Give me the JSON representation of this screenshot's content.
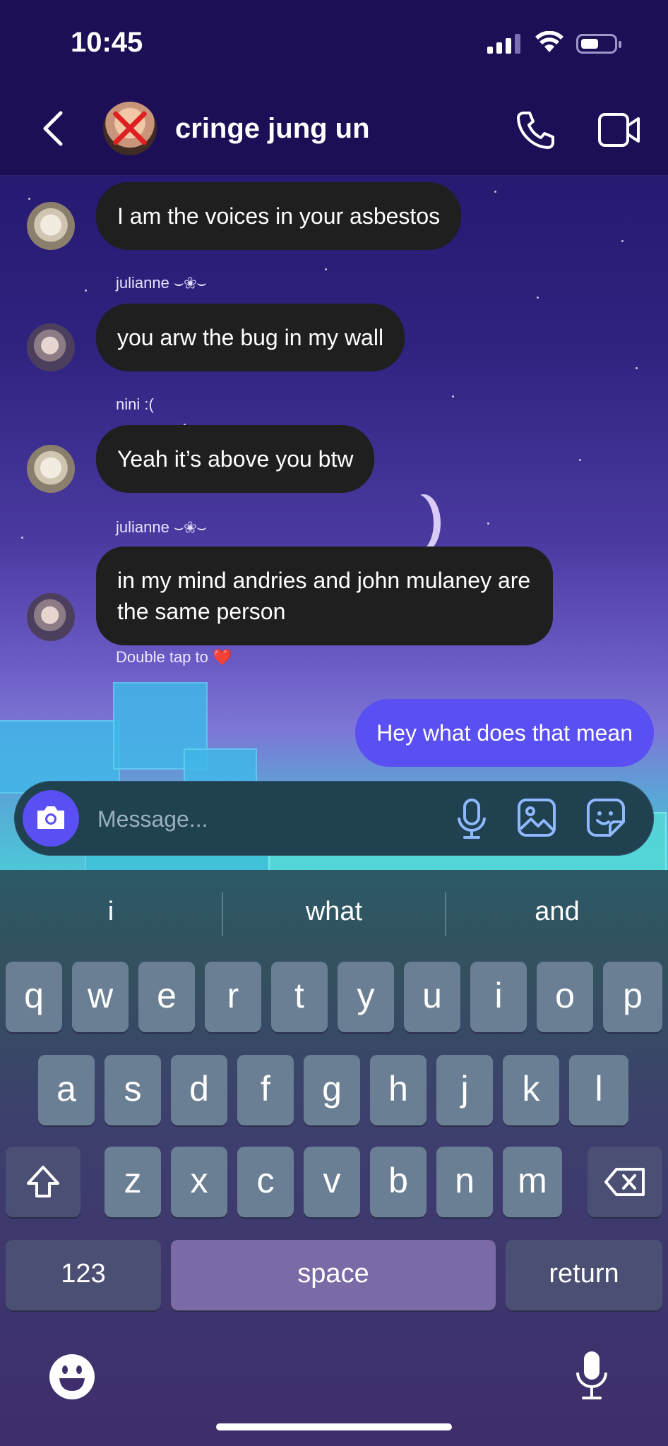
{
  "status_bar": {
    "time": "10:45"
  },
  "header": {
    "title": "cringe jung un"
  },
  "messages": [
    {
      "text": "I am the voices in your asbestos"
    },
    {
      "sender": "julianne ⌣❀⌣",
      "text": "you arw the bug in my wall"
    },
    {
      "sender": "nini :(",
      "text": "Yeah it’s above you btw"
    },
    {
      "sender": "julianne ⌣❀⌣",
      "text": "in my mind andries and john mulaney are the same person"
    }
  ],
  "double_tap_hint": "Double tap to ❤️",
  "my_message": "Hey what does that mean",
  "composer": {
    "placeholder": "Message..."
  },
  "keyboard": {
    "suggestions": [
      "i",
      "what",
      "and"
    ],
    "row1": [
      "q",
      "w",
      "e",
      "r",
      "t",
      "y",
      "u",
      "i",
      "o",
      "p"
    ],
    "row2": [
      "a",
      "s",
      "d",
      "f",
      "g",
      "h",
      "j",
      "k",
      "l"
    ],
    "row3": [
      "z",
      "x",
      "c",
      "v",
      "b",
      "n",
      "m"
    ],
    "numbers_label": "123",
    "space_label": "space",
    "return_label": "return"
  },
  "colors": {
    "accent": "#5a4ff2",
    "bubble_dark": "#1f1f20",
    "header_bg": "#1c0f56"
  },
  "icons": [
    "back-chevron-icon",
    "phone-icon",
    "video-camera-icon",
    "camera-icon",
    "microphone-icon",
    "image-icon",
    "sticker-icon",
    "shift-icon",
    "backspace-icon",
    "emoji-icon",
    "dictation-mic-icon"
  ]
}
